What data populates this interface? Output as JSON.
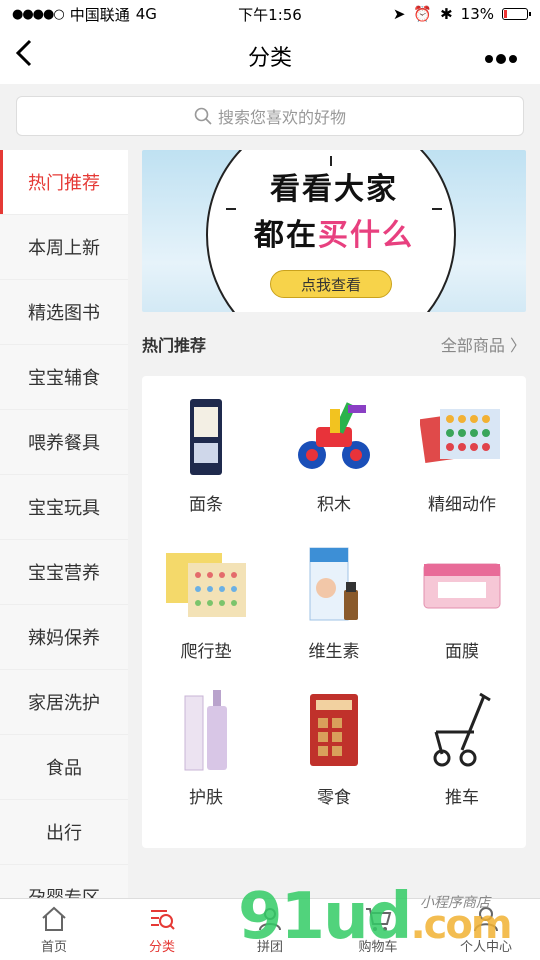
{
  "status": {
    "carrier": "中国联通",
    "network": "4G",
    "time": "下午1:56",
    "battery": "13%",
    "battery_level": 0.13
  },
  "nav": {
    "title": "分类",
    "back_icon": "chevron-left-icon",
    "more_icon": "more-dots-icon"
  },
  "search": {
    "placeholder": "搜索您喜欢的好物"
  },
  "sidebar": {
    "items": [
      {
        "label": "热门推荐"
      },
      {
        "label": "本周上新"
      },
      {
        "label": "精选图书"
      },
      {
        "label": "宝宝辅食"
      },
      {
        "label": "喂养餐具"
      },
      {
        "label": "宝宝玩具"
      },
      {
        "label": "宝宝营养"
      },
      {
        "label": "辣妈保养"
      },
      {
        "label": "家居洗护"
      },
      {
        "label": "食品"
      },
      {
        "label": "出行"
      },
      {
        "label": "孕婴专区"
      }
    ]
  },
  "banner": {
    "line1": "看看大家",
    "line2_a": "都在",
    "line2_b": "买什么",
    "button": "点我查看"
  },
  "section": {
    "title": "热门推荐",
    "more": "全部商品 〉"
  },
  "products": [
    {
      "label": "面条"
    },
    {
      "label": "积木"
    },
    {
      "label": "精细动作"
    },
    {
      "label": "爬行垫"
    },
    {
      "label": "维生素"
    },
    {
      "label": "面膜"
    },
    {
      "label": "护肤"
    },
    {
      "label": "零食"
    },
    {
      "label": "推车"
    }
  ],
  "tabbar": {
    "items": [
      {
        "label": "首页",
        "icon": "home-icon"
      },
      {
        "label": "分类",
        "icon": "category-search-icon"
      },
      {
        "label": "拼团",
        "icon": "group-icon"
      },
      {
        "label": "购物车",
        "icon": "cart-icon"
      },
      {
        "label": "个人中心",
        "icon": "user-icon"
      }
    ]
  },
  "watermark": {
    "main": "91ud",
    "tld": ".com",
    "sub": "小程序商店"
  },
  "colors": {
    "accent": "#e53935",
    "banner_pink": "#e8407f",
    "button_yellow": "#f7d34a"
  }
}
